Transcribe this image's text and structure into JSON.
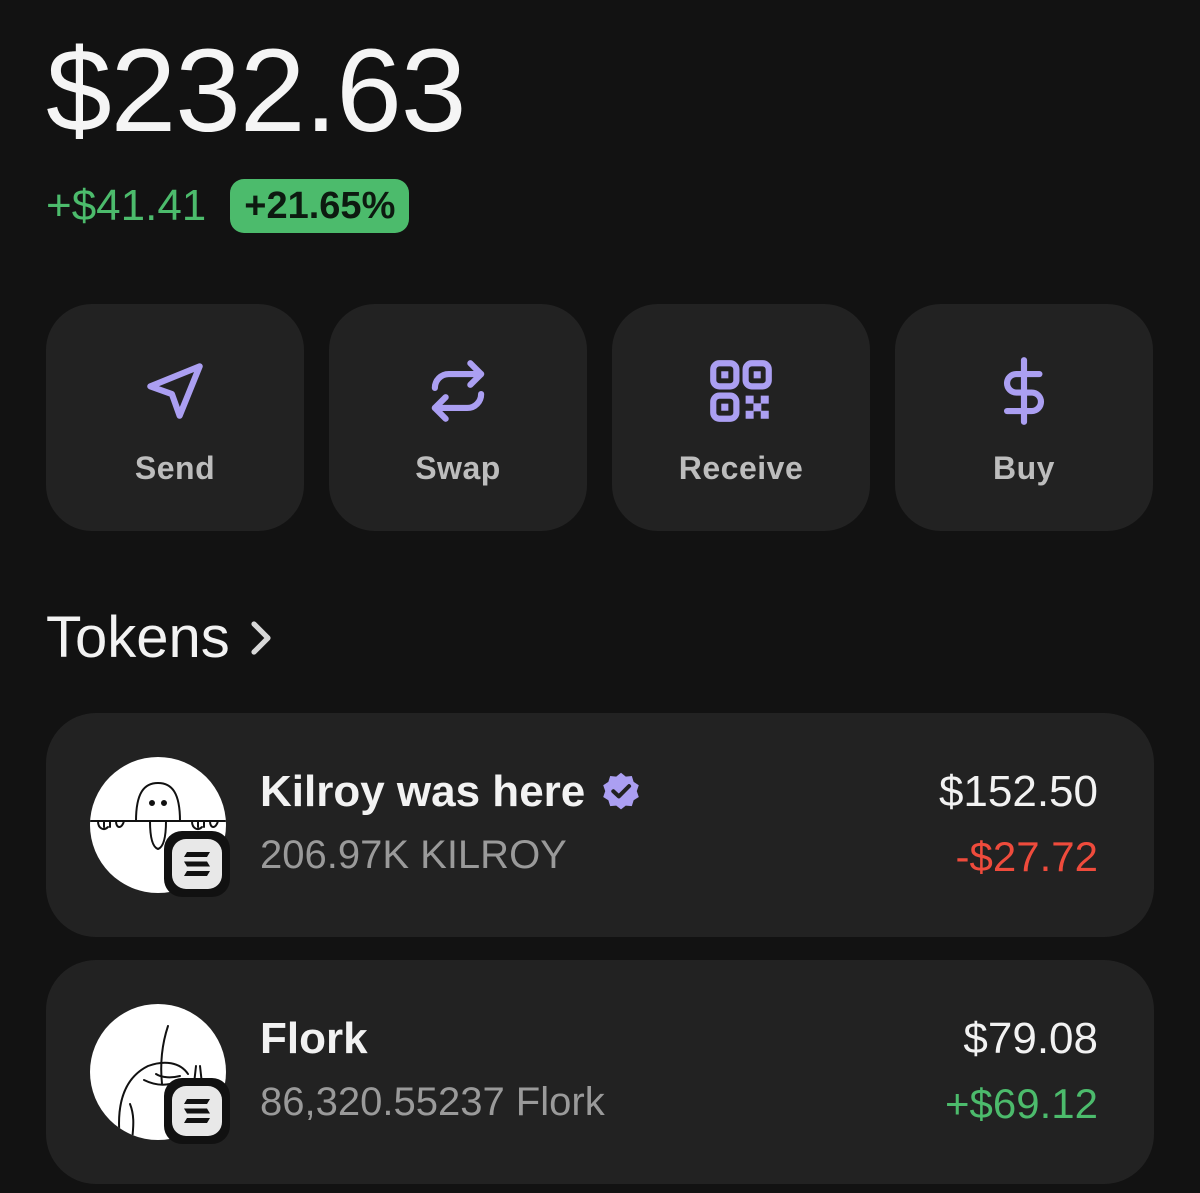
{
  "portfolio": {
    "balance": "$232.63",
    "change_amount": "+$41.41",
    "change_percent": "+21.65%"
  },
  "colors": {
    "accent": "#ab9ff2",
    "positive": "#4cbb6c",
    "negative": "#ef4b3c",
    "card": "#222222",
    "background": "#121212"
  },
  "actions": [
    {
      "label": "Send",
      "icon": "send-icon"
    },
    {
      "label": "Swap",
      "icon": "swap-icon"
    },
    {
      "label": "Receive",
      "icon": "qr-code-icon"
    },
    {
      "label": "Buy",
      "icon": "dollar-icon"
    }
  ],
  "tokens_section": {
    "title": "Tokens",
    "icon": "chevron-right-icon"
  },
  "tokens": [
    {
      "name": "Kilroy was here",
      "verified": true,
      "amount": "206.97K KILROY",
      "value": "$152.50",
      "change": "-$27.72",
      "change_direction": "negative",
      "logo_icon": "kilroy-logo-icon",
      "chain_icon": "solana-icon"
    },
    {
      "name": "Flork",
      "verified": false,
      "amount": "86,320.55237 Flork",
      "value": "$79.08",
      "change": "+$69.12",
      "change_direction": "positive",
      "logo_icon": "flork-logo-icon",
      "chain_icon": "solana-icon"
    }
  ]
}
